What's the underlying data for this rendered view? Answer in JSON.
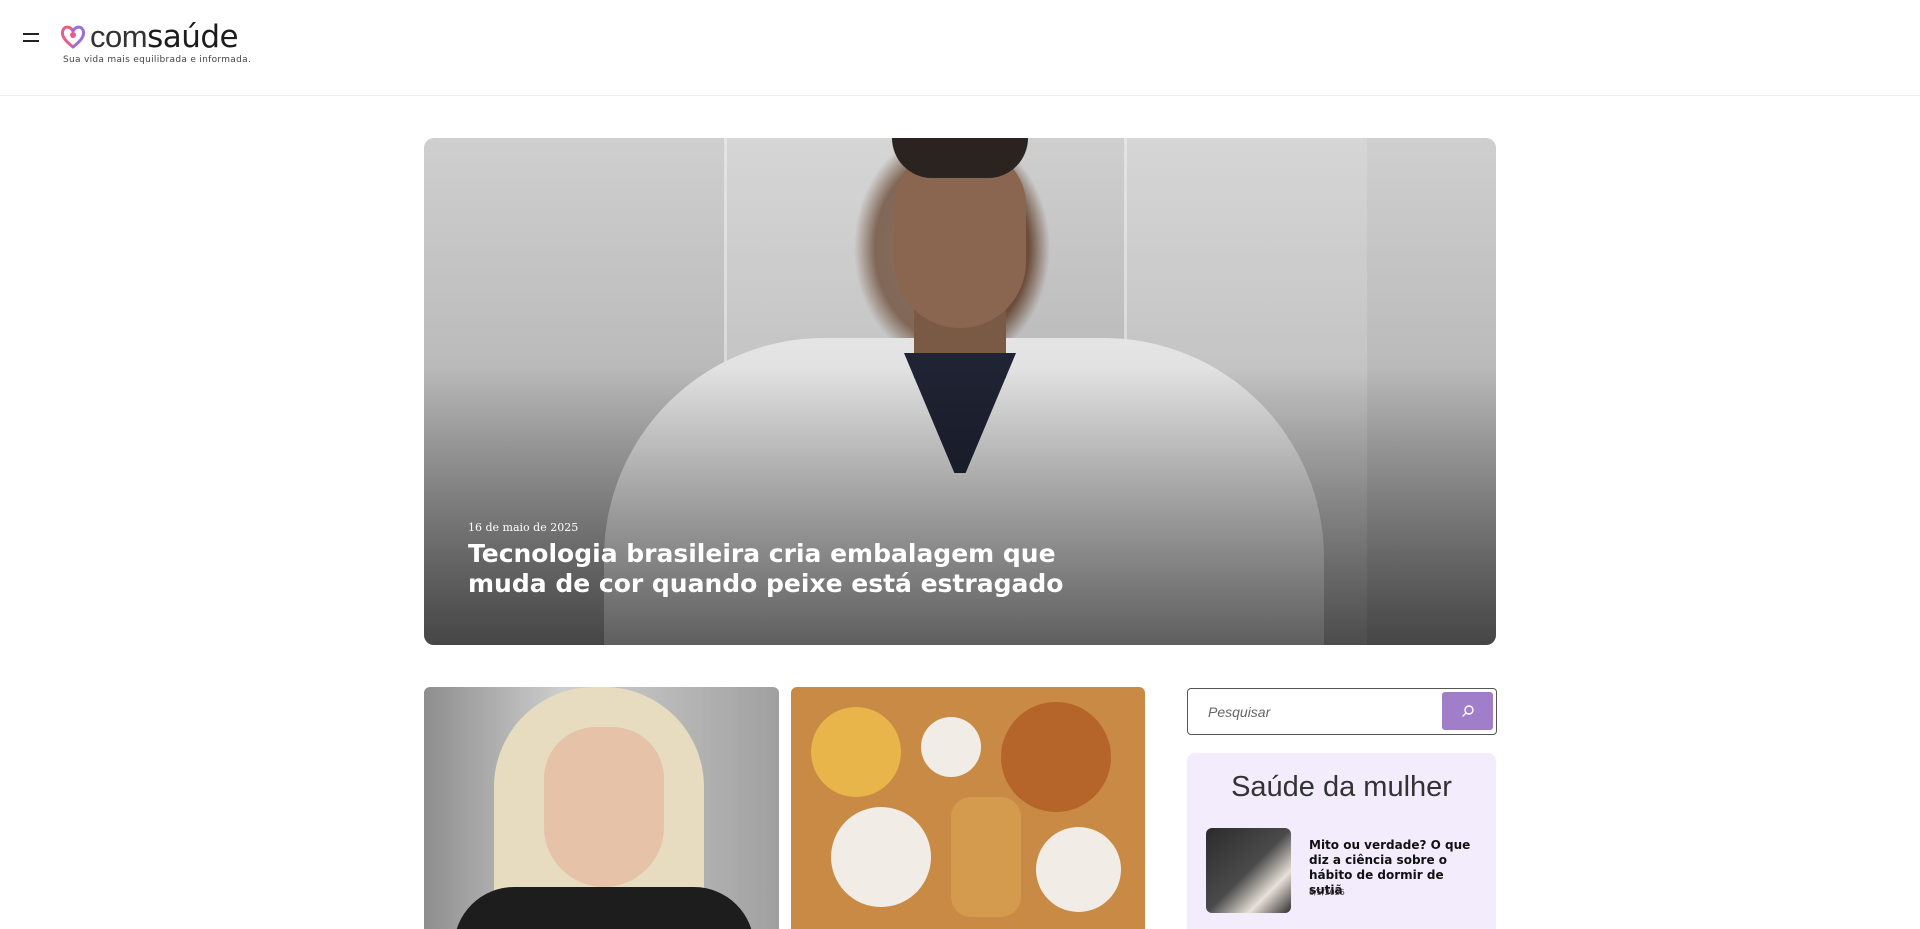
{
  "header": {
    "logo": {
      "part1": "com",
      "part2": "saúde"
    },
    "tagline": "Sua vida mais equilibrada e informada."
  },
  "hero": {
    "date": "16 de maio de 2025",
    "title": "Tecnologia brasileira cria embalagem que muda de cor quando peixe está estragado"
  },
  "search": {
    "placeholder": "Pesquisar"
  },
  "sidebar": {
    "section_title": "Saúde da mulher",
    "article": {
      "title": "Mito ou verdade? O que diz a ciência sobre o hábito de dormir de sutiã",
      "date": "6/5/2025"
    }
  },
  "colors": {
    "accent": "#a07ec9",
    "sidebar_bg": "#f3ecfc",
    "logo_heart_left": "#ea5a8a",
    "logo_heart_right": "#9b6fd3"
  },
  "icons": {
    "menu": "hamburger-menu-icon",
    "search": "search-icon",
    "logo": "heart-logo-icon"
  }
}
